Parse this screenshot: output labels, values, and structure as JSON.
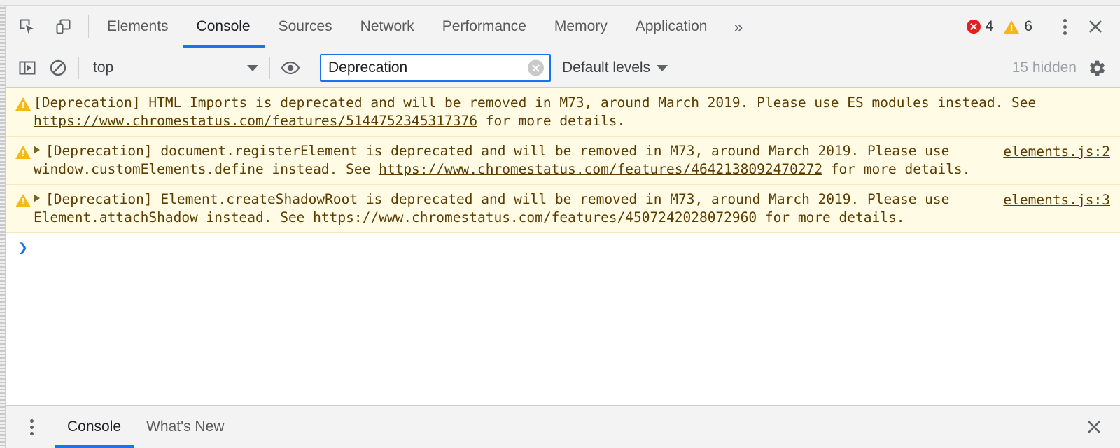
{
  "main_tabs": {
    "items": [
      {
        "label": "Elements",
        "active": false
      },
      {
        "label": "Console",
        "active": true
      },
      {
        "label": "Sources",
        "active": false
      },
      {
        "label": "Network",
        "active": false
      },
      {
        "label": "Performance",
        "active": false
      },
      {
        "label": "Memory",
        "active": false
      },
      {
        "label": "Application",
        "active": false
      }
    ],
    "overflow_label": "»",
    "inspect_icon": "inspect-element-icon",
    "device_icon": "device-toolbar-icon"
  },
  "status": {
    "error_count": "4",
    "warning_count": "6",
    "error_icon": "error-circle-icon",
    "warning_icon": "warning-triangle-icon",
    "more_icon": "kebab-menu-icon",
    "close_icon": "close-icon",
    "error_color": "#e02020",
    "warning_color": "#f5b719"
  },
  "console_toolbar": {
    "sidebar_toggle_icon": "console-sidebar-icon",
    "clear_icon": "clear-console-icon",
    "context": {
      "value": "top",
      "caret_icon": "chevron-down-icon"
    },
    "live_expression_icon": "eye-icon",
    "filter": {
      "value": "Deprecation",
      "placeholder": "Filter",
      "clear_icon": "clear-filter-icon"
    },
    "levels": {
      "label": "Default levels",
      "caret_icon": "chevron-down-icon"
    },
    "hidden_label": "15 hidden",
    "settings_icon": "gear-icon"
  },
  "messages": [
    {
      "level": "warning",
      "expandable": false,
      "text_before": "[Deprecation] HTML Imports is deprecated and will be removed in M73, around March 2019. Please use ES modules instead. See ",
      "link": "https://www.chromestatus.com/features/5144752345317376",
      "text_after": " for more details.",
      "source": ""
    },
    {
      "level": "warning",
      "expandable": true,
      "text_before": "[Deprecation] document.registerElement is deprecated and will be removed in M73, around March 2019. Please use window.customElements.define instead. See ",
      "link": "https://www.chromestatus.com/features/4642138092470272",
      "text_after": " for more details.",
      "source": "elements.js:2"
    },
    {
      "level": "warning",
      "expandable": true,
      "text_before": "[Deprecation] Element.createShadowRoot is deprecated and will be removed in M73, around March 2019. Please use Element.attachShadow instead. See ",
      "link": "https://www.chromestatus.com/features/4507242028072960",
      "text_after": " for more details.",
      "source": "elements.js:3"
    }
  ],
  "prompt": {
    "chevron": "❯",
    "value": ""
  },
  "drawer": {
    "menu_icon": "kebab-menu-icon",
    "tabs": [
      {
        "label": "Console",
        "active": true
      },
      {
        "label": "What's New",
        "active": false
      }
    ],
    "close_icon": "close-icon"
  },
  "colors": {
    "accent": "#1a73e8",
    "warning_bg": "#fffbe5",
    "warning_text": "#5c3c00",
    "toolbar_bg": "#f3f3f3"
  }
}
